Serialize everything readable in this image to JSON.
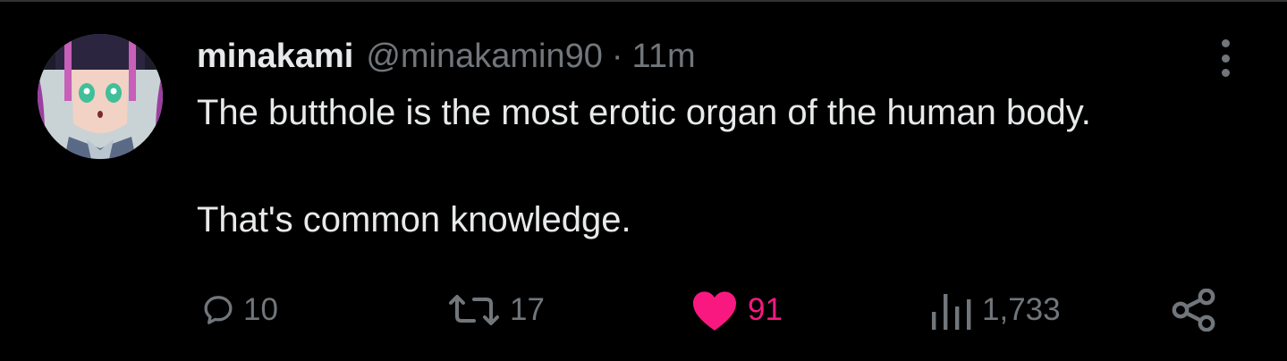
{
  "tweet": {
    "display_name": "minakami",
    "handle": "@minakamin90",
    "separator": "·",
    "time": "11m",
    "text_line1": "The butthole is the most erotic organ of the human body.",
    "text_line2": "That's common knowledge."
  },
  "actions": {
    "replies": "10",
    "reposts": "17",
    "likes": "91",
    "views": "1,733"
  },
  "icons": {
    "reply": "speech-bubble-icon",
    "repost": "repost-arrows-icon",
    "like": "heart-filled-icon",
    "views": "bar-chart-icon",
    "share": "share-nodes-icon",
    "more": "vertical-dots-icon"
  },
  "colors": {
    "background": "#000000",
    "text": "#e7e9ea",
    "muted": "#71767b",
    "like": "#f91880"
  }
}
